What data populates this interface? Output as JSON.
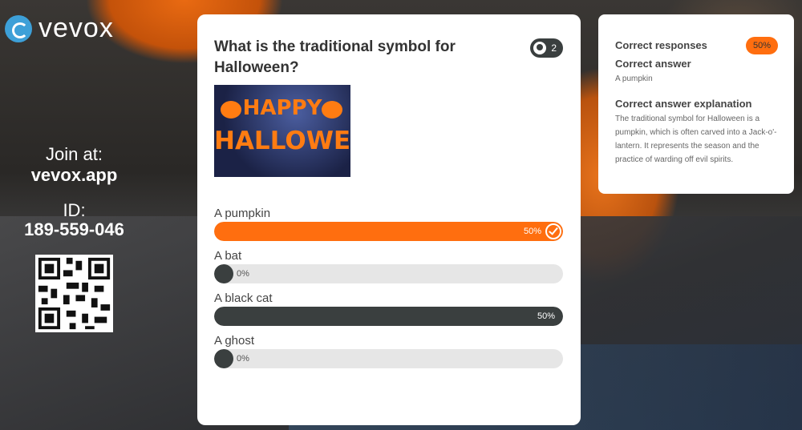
{
  "brand": {
    "name": "vevox"
  },
  "join": {
    "label": "Join at:",
    "url": "vevox.app",
    "id_label": "ID:",
    "id": "189-559-046"
  },
  "question": {
    "title": "What is the traditional symbol for Halloween?",
    "response_count": "2",
    "image_text_1": "HAPPY",
    "image_text_2": "HALLOWEEN"
  },
  "options": [
    {
      "label": "A pumpkin",
      "percent_text": "50%",
      "value": 50,
      "correct": true,
      "color": "#ff6e0f"
    },
    {
      "label": "A bat",
      "percent_text": "0%",
      "value": 0,
      "correct": false,
      "color": "#3a3f3f"
    },
    {
      "label": "A black cat",
      "percent_text": "50%",
      "value": 50,
      "correct": false,
      "color": "#3a3f3f"
    },
    {
      "label": "A ghost",
      "percent_text": "0%",
      "value": 0,
      "correct": false,
      "color": "#3a3f3f"
    }
  ],
  "side": {
    "correct_responses_label": "Correct responses",
    "correct_responses_value": "50%",
    "correct_answer_label": "Correct answer",
    "correct_answer": "A pumpkin",
    "explanation_label": "Correct answer explanation",
    "explanation": "The traditional symbol for Halloween is a pumpkin, which is often carved into a Jack-o'-lantern. It represents the season and the practice of warding off evil spirits."
  },
  "colors": {
    "accent": "#ff6e0f",
    "dark": "#3a3f3f",
    "track": "#e6e6e6"
  }
}
